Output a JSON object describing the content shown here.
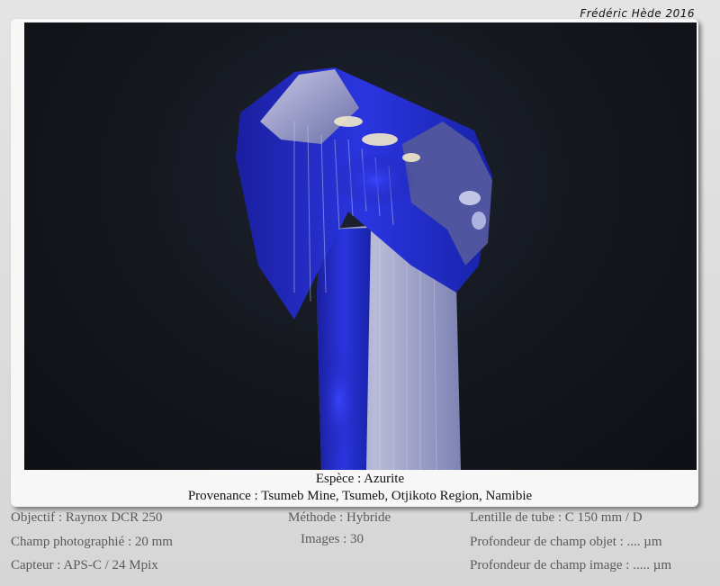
{
  "credit": "Frédéric Hède 2016",
  "caption": {
    "species": "Espèce : Azurite",
    "origin": "Provenance : Tsumeb Mine, Tsumeb, Otjikoto Region, Namibie"
  },
  "specs": {
    "objective": "Objectif : Raynox DCR 250",
    "field": "Champ photographié : 20 mm",
    "sensor": "Capteur : APS-C / 24 Mpix",
    "method": "Méthode : Hybride",
    "images": "Images : 30",
    "tube_lens": "Lentille de tube : C 150 mm / D",
    "object_dof": "Profondeur de champ objet : .... µm",
    "image_dof": "Profondeur de champ image : ..... µm"
  }
}
